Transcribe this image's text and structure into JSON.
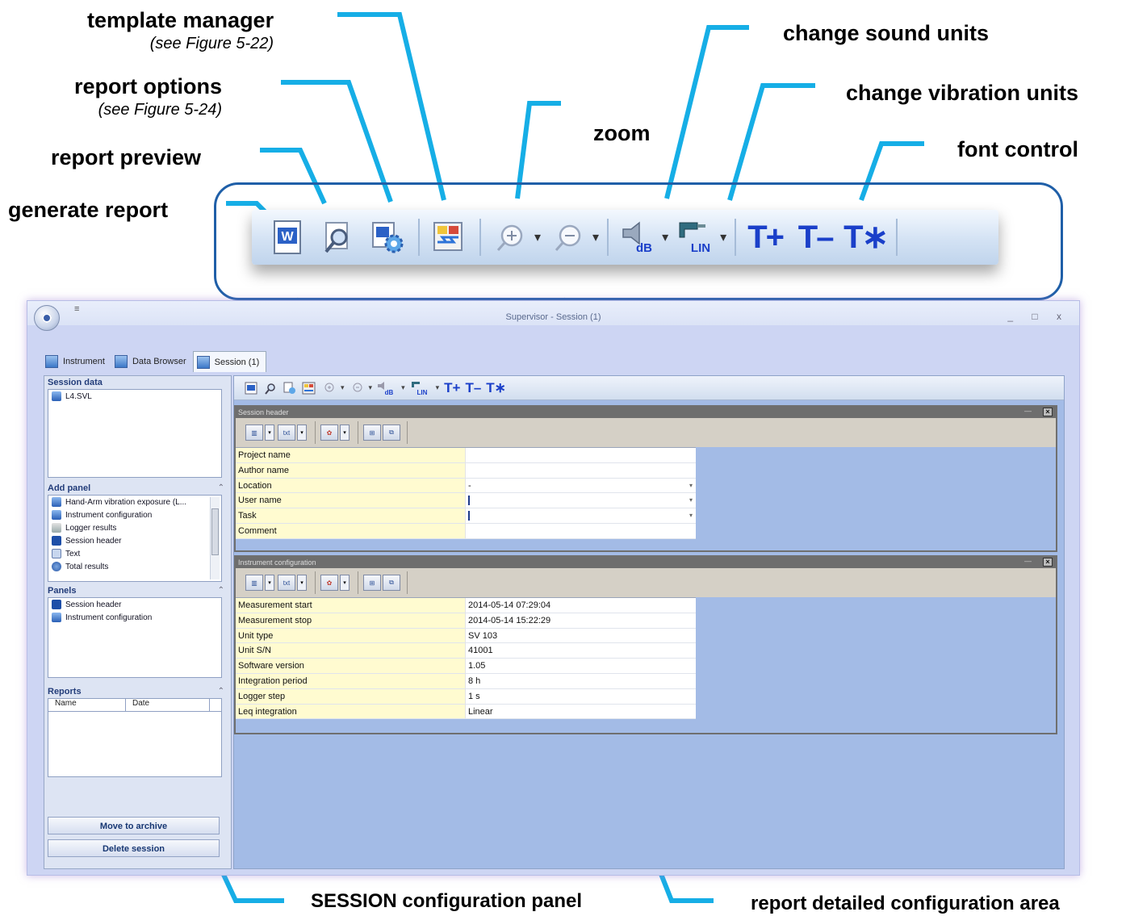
{
  "callouts": {
    "template_manager": "template manager",
    "template_manager_ref": "(see Figure 5-22)",
    "report_options": "report options",
    "report_options_ref": "(see Figure 5-24)",
    "report_preview": "report preview",
    "generate_report": "generate report",
    "zoom": "zoom",
    "change_sound_units": "change sound units",
    "change_vibration_units": "change vibration units",
    "font_control": "font control",
    "session_panel": "SESSION configuration panel",
    "report_area": "report detailed configuration area"
  },
  "toolbar_big": {
    "db_label": "dB",
    "lin_label": "LIN",
    "font_plus": "T+",
    "font_minus": "T–",
    "font_reset": "T∗"
  },
  "window": {
    "quick_access": "≡",
    "title": "Supervisor - Session (1)",
    "controls": "_ □ x",
    "tabs": [
      {
        "label": "Instrument"
      },
      {
        "label": "Data Browser"
      },
      {
        "label": "Session (1)"
      }
    ]
  },
  "left_panel": {
    "session_data_title": "Session data",
    "session_files": [
      "L4.SVL"
    ],
    "add_panel_title": "Add panel",
    "add_panel_items": [
      {
        "label": "Hand-Arm vibration exposure (L...",
        "icon": "vibration-icon"
      },
      {
        "label": "Instrument configuration",
        "icon": "instrument-icon"
      },
      {
        "label": "Logger results",
        "icon": "logger-icon"
      },
      {
        "label": "Session header",
        "icon": "info-icon"
      },
      {
        "label": "Text",
        "icon": "text-icon"
      },
      {
        "label": "Total results",
        "icon": "total-icon"
      }
    ],
    "panels_title": "Panels",
    "panels_items": [
      {
        "label": "Session header",
        "icon": "info-icon"
      },
      {
        "label": "Instrument configuration",
        "icon": "instrument-icon"
      }
    ],
    "reports_title": "Reports",
    "reports_columns": [
      "Name",
      "Date"
    ],
    "move_to_archive": "Move to archive",
    "delete_session": "Delete session"
  },
  "report_area": {
    "small_db": "dB",
    "small_lin": "LIN",
    "small_font_plus": "T+",
    "small_font_minus": "T–",
    "small_font_reset": "T∗",
    "session_header": {
      "title": "Session header",
      "rows": [
        {
          "name": "Project name",
          "value": ""
        },
        {
          "name": "Author name",
          "value": ""
        },
        {
          "name": "Location",
          "value": "-"
        },
        {
          "name": "User name",
          "value": ""
        },
        {
          "name": "Task",
          "value": ""
        },
        {
          "name": "Comment",
          "value": ""
        }
      ]
    },
    "instrument_configuration": {
      "title": "Instrument configuration",
      "rows": [
        {
          "name": "Measurement start",
          "value": "2014-05-14 07:29:04"
        },
        {
          "name": "Measurement stop",
          "value": "2014-05-14 15:22:29"
        },
        {
          "name": "Unit type",
          "value": "SV 103"
        },
        {
          "name": "Unit S/N",
          "value": "41001"
        },
        {
          "name": "Software version",
          "value": "1.05"
        },
        {
          "name": "Integration period",
          "value": "8 h"
        },
        {
          "name": "Logger step",
          "value": "1 s"
        },
        {
          "name": "Leq integration",
          "value": "Linear"
        }
      ]
    }
  },
  "colors": {
    "callout_line": "#16aee6",
    "frame": "#1f5fa8",
    "font_glyph": "#1a3fc9"
  }
}
